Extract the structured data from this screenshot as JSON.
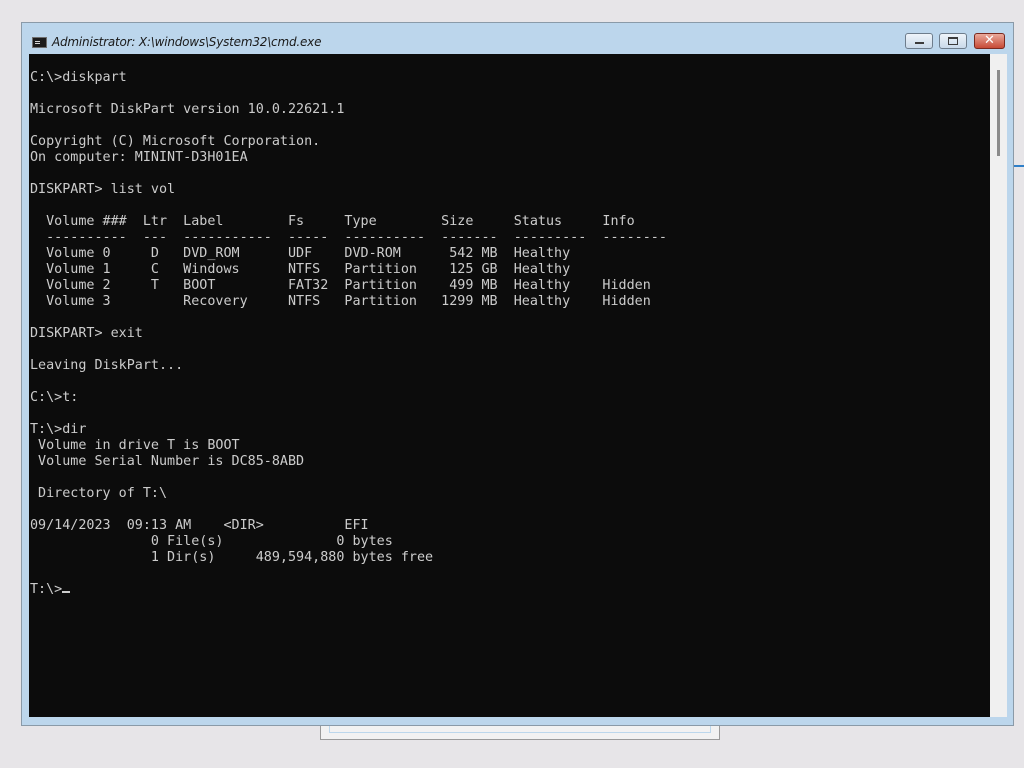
{
  "window": {
    "title": "Administrator: X:\\windows\\System32\\cmd.exe",
    "icon": "console-icon",
    "controls": {
      "minimize": "minimize-icon",
      "maximize": "maximize-icon",
      "close": "close-icon",
      "close_glyph": "✕"
    }
  },
  "console": {
    "background": "#0c0c0c",
    "foreground": "#cccccc",
    "lines": [
      "C:\\>diskpart",
      "",
      "Microsoft DiskPart version 10.0.22621.1",
      "",
      "Copyright (C) Microsoft Corporation.",
      "On computer: MININT-D3H01EA",
      "",
      "DISKPART> list vol",
      "",
      "  Volume ###  Ltr  Label        Fs     Type        Size     Status     Info",
      "  ----------  ---  -----------  -----  ----------  -------  ---------  --------",
      "  Volume 0     D   DVD_ROM      UDF    DVD-ROM      542 MB  Healthy",
      "  Volume 1     C   Windows      NTFS   Partition    125 GB  Healthy",
      "  Volume 2     T   BOOT         FAT32  Partition    499 MB  Healthy    Hidden",
      "  Volume 3         Recovery     NTFS   Partition   1299 MB  Healthy    Hidden",
      "",
      "DISKPART> exit",
      "",
      "Leaving DiskPart...",
      "",
      "C:\\>t:",
      "",
      "T:\\>dir",
      " Volume in drive T is BOOT",
      " Volume Serial Number is DC85-8ABD",
      "",
      " Directory of T:\\",
      "",
      "09/14/2023  09:13 AM    <DIR>          EFI",
      "               0 File(s)              0 bytes",
      "               1 Dir(s)     489,594,880 bytes free",
      ""
    ],
    "prompt": "T:\\>"
  }
}
